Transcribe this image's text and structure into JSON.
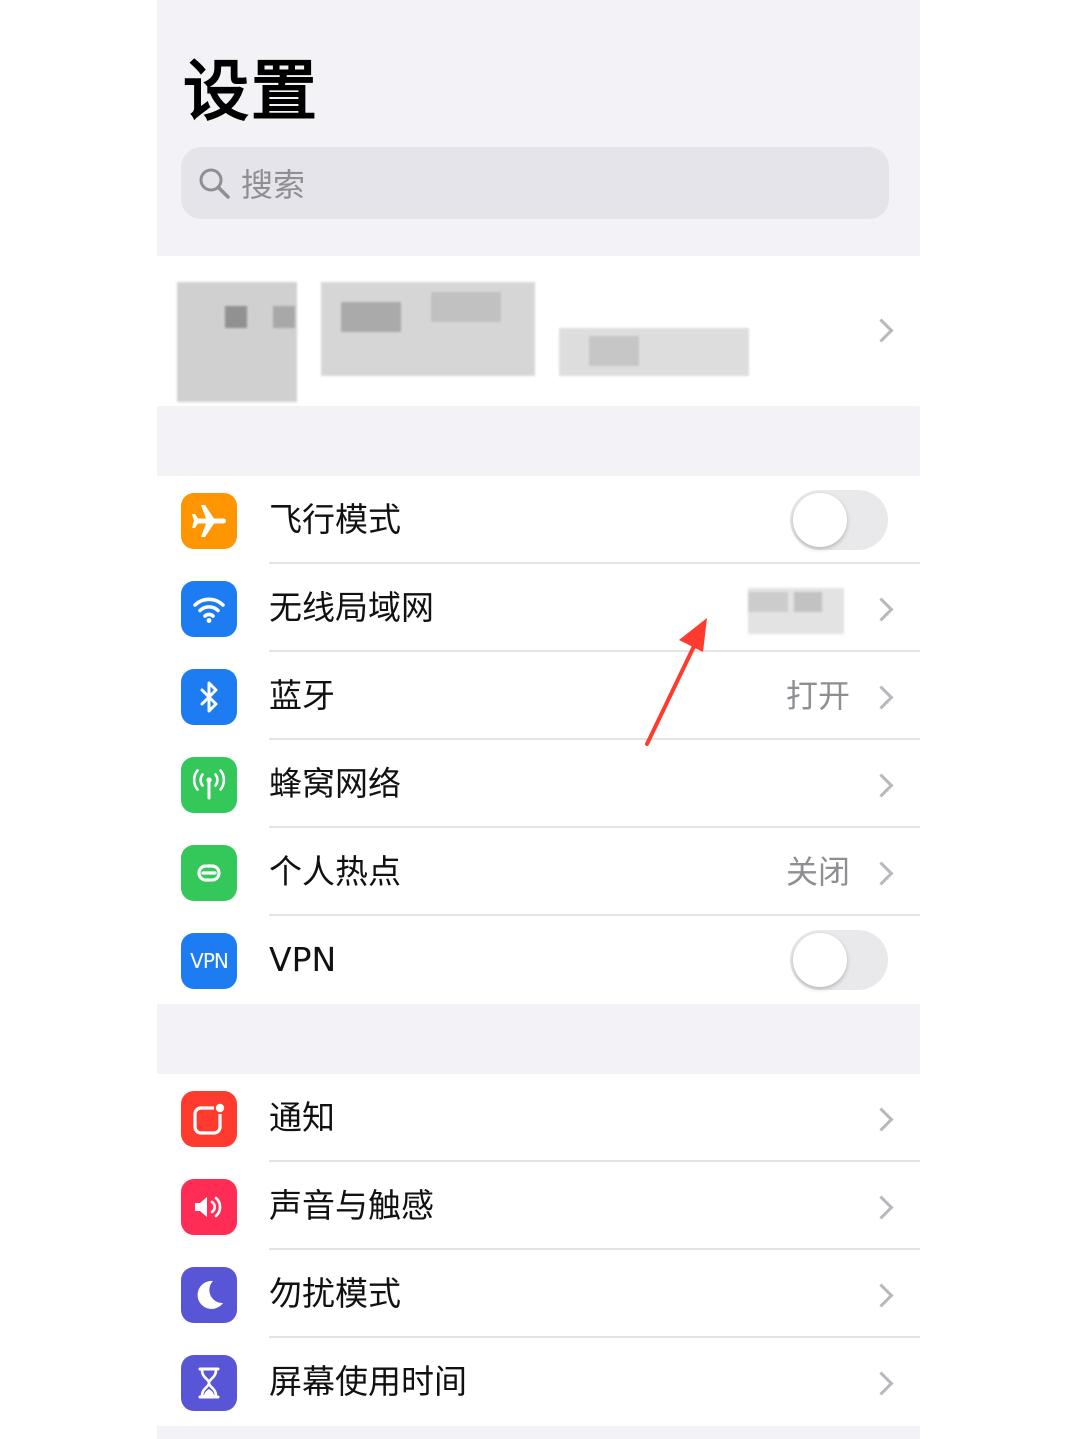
{
  "header": {
    "title": "设置"
  },
  "search": {
    "placeholder": "搜索"
  },
  "network_group": [
    {
      "label": "飞行模式",
      "icon": "airplane-icon",
      "color": "#ff9500",
      "control": "toggle",
      "on": false
    },
    {
      "label": "无线局域网",
      "icon": "wifi-icon",
      "color": "#1e7cf2",
      "control": "chevron",
      "value": ""
    },
    {
      "label": "蓝牙",
      "icon": "bluetooth-icon",
      "color": "#1e7cf2",
      "control": "chevron",
      "value": "打开"
    },
    {
      "label": "蜂窝网络",
      "icon": "cellular-icon",
      "color": "#34c759",
      "control": "chevron",
      "value": ""
    },
    {
      "label": "个人热点",
      "icon": "hotspot-icon",
      "color": "#34c759",
      "control": "chevron",
      "value": "关闭"
    },
    {
      "label": "VPN",
      "icon": "vpn-icon",
      "icon_text": "VPN",
      "color": "#1e7cf2",
      "control": "toggle",
      "on": false
    }
  ],
  "notify_group": [
    {
      "label": "通知",
      "icon": "notifications-icon",
      "color": "#ff3b30"
    },
    {
      "label": "声音与触感",
      "icon": "sound-icon",
      "color": "#ff2d55"
    },
    {
      "label": "勿扰模式",
      "icon": "moon-icon",
      "color": "#5856d6"
    },
    {
      "label": "屏幕使用时间",
      "icon": "hourglass-icon",
      "color": "#5856d6"
    }
  ],
  "annotation": {
    "color": "#ff3b30"
  }
}
